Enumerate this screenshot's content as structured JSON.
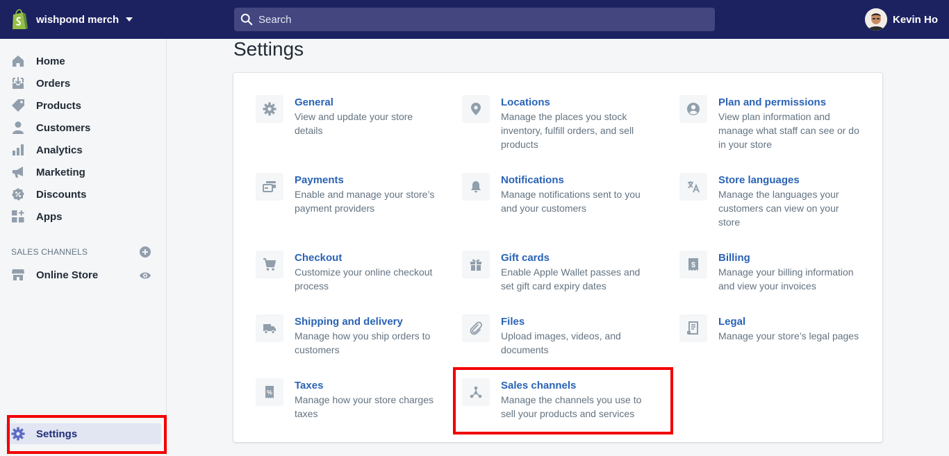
{
  "topbar": {
    "store_name": "wishpond merch",
    "search_placeholder": "Search",
    "user_name": "Kevin Ho"
  },
  "sidebar": {
    "items": [
      {
        "label": "Home",
        "icon": "home-icon"
      },
      {
        "label": "Orders",
        "icon": "orders-icon"
      },
      {
        "label": "Products",
        "icon": "tag-icon"
      },
      {
        "label": "Customers",
        "icon": "person-icon"
      },
      {
        "label": "Analytics",
        "icon": "bar-chart-icon"
      },
      {
        "label": "Marketing",
        "icon": "megaphone-icon"
      },
      {
        "label": "Discounts",
        "icon": "discount-icon"
      },
      {
        "label": "Apps",
        "icon": "apps-icon"
      }
    ],
    "sales_channels_title": "SALES CHANNELS",
    "online_store_label": "Online Store",
    "settings_label": "Settings"
  },
  "main": {
    "title": "Settings",
    "settings": [
      {
        "title": "General",
        "desc": "View and update your store details",
        "icon": "gear-icon"
      },
      {
        "title": "Locations",
        "desc": "Manage the places you stock inventory, fulfill orders, and sell products",
        "icon": "location-pin-icon"
      },
      {
        "title": "Plan and permissions",
        "desc": "View plan information and manage what staff can see or do in your store",
        "icon": "user-circle-icon"
      },
      {
        "title": "Payments",
        "desc": "Enable and manage your store’s payment providers",
        "icon": "payments-icon"
      },
      {
        "title": "Notifications",
        "desc": "Manage notifications sent to you and your customers",
        "icon": "bell-icon"
      },
      {
        "title": "Store languages",
        "desc": "Manage the languages your customers can view on your store",
        "icon": "translate-icon"
      },
      {
        "title": "Checkout",
        "desc": "Customize your online checkout process",
        "icon": "cart-icon"
      },
      {
        "title": "Gift cards",
        "desc": "Enable Apple Wallet passes and set gift card expiry dates",
        "icon": "gift-icon"
      },
      {
        "title": "Billing",
        "desc": "Manage your billing information and view your invoices",
        "icon": "dollar-bill-icon"
      },
      {
        "title": "Shipping and delivery",
        "desc": "Manage how you ship orders to customers",
        "icon": "truck-icon"
      },
      {
        "title": "Files",
        "desc": "Upload images, videos, and documents",
        "icon": "paperclip-icon"
      },
      {
        "title": "Legal",
        "desc": "Manage your store’s legal pages",
        "icon": "legal-document-icon"
      },
      {
        "title": "Taxes",
        "desc": "Manage how your store charges taxes",
        "icon": "tax-receipt-icon"
      },
      {
        "title": "Sales channels",
        "desc": "Manage the channels you use to sell your products and services",
        "icon": "channels-icon"
      }
    ]
  },
  "colors": {
    "topbar": "#1c2260",
    "link": "#2a63b5",
    "highlight": "#f20000"
  }
}
